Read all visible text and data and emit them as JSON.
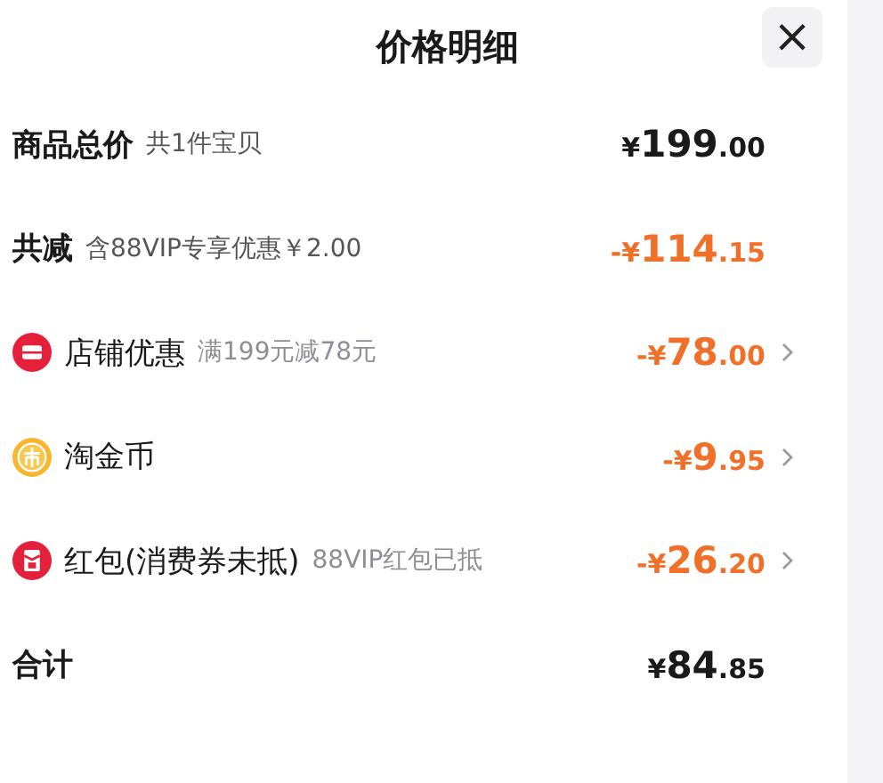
{
  "title": "价格明细",
  "close": "×",
  "rows": [
    {
      "kind": "summary",
      "label": "商品总价",
      "note": "共1件宝贝",
      "highlight": false,
      "arrow": false,
      "amount": {
        "currency": "¥",
        "integer": "199",
        "decimal": ".00"
      }
    },
    {
      "kind": "summary",
      "label": "共减",
      "note": "含88VIP专享优惠￥2.00",
      "highlight": true,
      "arrow": false,
      "amount": {
        "currency": "-¥",
        "integer": "114",
        "decimal": ".15"
      }
    },
    {
      "kind": "shop",
      "label": "店铺优惠",
      "note": "满199元减78元",
      "highlight": true,
      "arrow": true,
      "amount": {
        "currency": "-¥",
        "integer": "78",
        "decimal": ".00"
      }
    },
    {
      "kind": "coin",
      "label": "淘金币",
      "highlight": true,
      "arrow": true,
      "amount": {
        "currency": "-¥",
        "integer": "9",
        "decimal": ".95"
      }
    },
    {
      "kind": "packet",
      "label": "红包(消费券未抵)",
      "note": "88VIP红包已抵",
      "highlight": true,
      "arrow": true,
      "amount": {
        "currency": "-¥",
        "integer": "26",
        "decimal": ".20"
      }
    },
    {
      "kind": "summary",
      "label": "合计",
      "highlight": false,
      "arrow": false,
      "amount": {
        "currency": "¥",
        "integer": "84",
        "decimal": ".85"
      }
    }
  ]
}
